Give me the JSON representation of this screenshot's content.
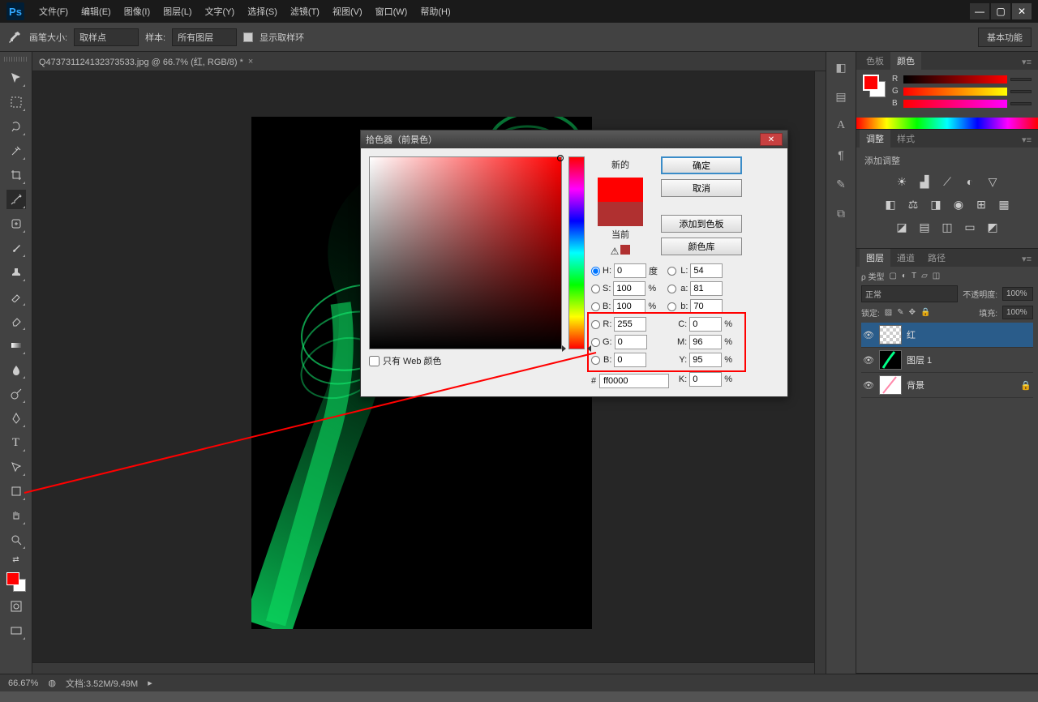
{
  "menu": {
    "items": [
      "文件(F)",
      "编辑(E)",
      "图像(I)",
      "图层(L)",
      "文字(Y)",
      "选择(S)",
      "滤镜(T)",
      "视图(V)",
      "窗口(W)",
      "帮助(H)"
    ]
  },
  "options": {
    "brush_size_label": "画笔大小:",
    "brush_size_value": "取样点",
    "sample_label": "样本:",
    "sample_value": "所有图层",
    "show_ring_label": "显示取样环",
    "right_button": "基本功能"
  },
  "doc_tab": "Q473731124132373533.jpg @ 66.7% (红, RGB/8) *",
  "right_panels": {
    "color": {
      "tab1": "色板",
      "tab2": "颜色",
      "r_label": "R",
      "g_label": "G",
      "b_label": "B"
    },
    "adjust": {
      "tab1": "调整",
      "tab2": "样式",
      "title": "添加调整"
    },
    "layers": {
      "tab1": "图层",
      "tab2": "通道",
      "tab3": "路径",
      "kind_label": "ρ 类型",
      "mode": "正常",
      "opacity_label": "不透明度:",
      "opacity_val": "100%",
      "lock_label": "锁定:",
      "fill_label": "填充:",
      "fill_val": "100%",
      "items": [
        {
          "name": "红"
        },
        {
          "name": "图层 1"
        },
        {
          "name": "背景"
        }
      ]
    }
  },
  "dialog": {
    "title": "拾色器（前景色）",
    "new_label": "新的",
    "current_label": "当前",
    "ok": "确定",
    "cancel": "取消",
    "add_swatch": "添加到色板",
    "color_lib": "颜色库",
    "web_only": "只有 Web 颜色",
    "fields": {
      "H": {
        "label": "H:",
        "value": "0",
        "unit": "度"
      },
      "S": {
        "label": "S:",
        "value": "100",
        "unit": "%"
      },
      "Bv": {
        "label": "B:",
        "value": "100",
        "unit": "%"
      },
      "R": {
        "label": "R:",
        "value": "255",
        "unit": ""
      },
      "G": {
        "label": "G:",
        "value": "0",
        "unit": ""
      },
      "Bc": {
        "label": "B:",
        "value": "0",
        "unit": ""
      },
      "L": {
        "label": "L:",
        "value": "54",
        "unit": ""
      },
      "a": {
        "label": "a:",
        "value": "81",
        "unit": ""
      },
      "b2": {
        "label": "b:",
        "value": "70",
        "unit": ""
      },
      "C": {
        "label": "C:",
        "value": "0",
        "unit": "%"
      },
      "M": {
        "label": "M:",
        "value": "96",
        "unit": "%"
      },
      "Y": {
        "label": "Y:",
        "value": "95",
        "unit": "%"
      },
      "K": {
        "label": "K:",
        "value": "0",
        "unit": "%"
      }
    },
    "hex_label": "#",
    "hex_value": "ff0000"
  },
  "status": {
    "zoom": "66.67%",
    "doc": "文档:3.52M/9.49M"
  }
}
